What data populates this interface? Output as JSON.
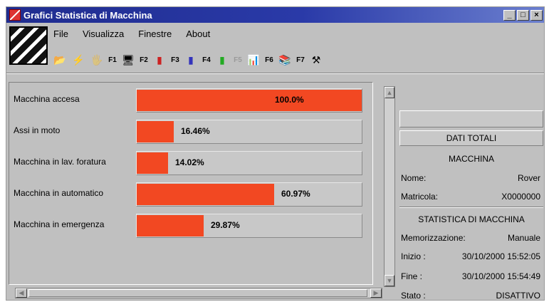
{
  "window": {
    "title": "Grafici Statistica di Macchina",
    "buttons": {
      "minimize": "_",
      "maximize": "□",
      "close": "×"
    }
  },
  "menu": {
    "items": [
      "File",
      "Visualizza",
      "Finestre",
      "About"
    ]
  },
  "toolbar": {
    "items": [
      {
        "icon": "open-folder-icon",
        "key": ""
      },
      {
        "icon": "lightning-icon",
        "key": ""
      },
      {
        "icon": "disabled-tool-icon",
        "key": "F1"
      },
      {
        "icon": "monitor-icon",
        "key": "F2"
      },
      {
        "icon": "red-machine-icon",
        "key": "F3"
      },
      {
        "icon": "blue-machine-icon",
        "key": "F4"
      },
      {
        "icon": "green-machine-icon",
        "key": "F5"
      },
      {
        "icon": "bar-chart-icon",
        "key": "F6"
      },
      {
        "icon": "books-icon",
        "key": "F7"
      },
      {
        "icon": "tools-icon",
        "key": ""
      }
    ]
  },
  "bars": [
    {
      "label": "Macchina accesa",
      "value": 100.0,
      "text": "100.0%"
    },
    {
      "label": "Assi in moto",
      "value": 16.46,
      "text": "16.46%"
    },
    {
      "label": "Macchina in lav. foratura",
      "value": 14.02,
      "text": "14.02%"
    },
    {
      "label": "Macchina in automatico",
      "value": 60.97,
      "text": "60.97%"
    },
    {
      "label": "Macchina in emergenza",
      "value": 29.87,
      "text": "29.87%"
    }
  ],
  "colors": {
    "bar": "#f24822",
    "titlebar": "#1f2c8f"
  },
  "side": {
    "header": "DATI TOTALI",
    "machine_title": "MACCHINA",
    "name_label": "Nome:",
    "name_value": "Rover",
    "serial_label": "Matricola:",
    "serial_value": "X0000000",
    "stats_title": "STATISTICA DI MACCHINA",
    "memo_label": "Memorizzazione:",
    "memo_value": "Manuale",
    "start_label": "Inizio :",
    "start_value": "30/10/2000  15:52:05",
    "end_label": "Fine  :",
    "end_value": "30/10/2000  15:54:49",
    "state_label": "Stato :",
    "state_value": "DISATTIVO"
  }
}
